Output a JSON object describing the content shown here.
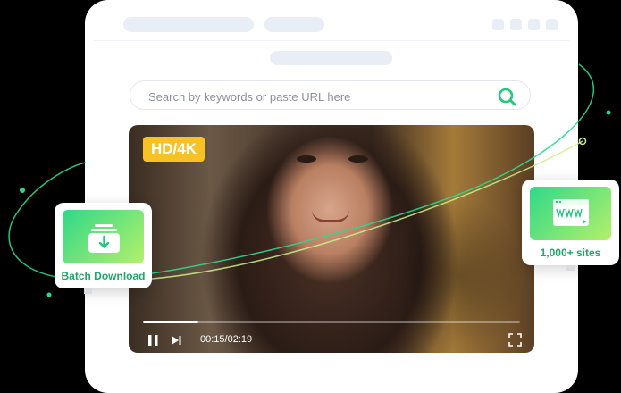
{
  "search": {
    "placeholder": "Search by keywords or paste URL here",
    "icon": "search-icon"
  },
  "video": {
    "badge": "HD/4K",
    "time": "00:15/02:19",
    "progress_fraction": 0.148
  },
  "cards": {
    "batch": {
      "label": "Batch Download",
      "icon": "download-icon"
    },
    "sites": {
      "label": "1,000+ sites",
      "icon": "www-browser-icon"
    }
  },
  "colors": {
    "accent_green": "#1ea86b",
    "badge_yellow": "#f6c224",
    "gradient_start": "#2fd88a",
    "gradient_end": "#b4f06a"
  }
}
